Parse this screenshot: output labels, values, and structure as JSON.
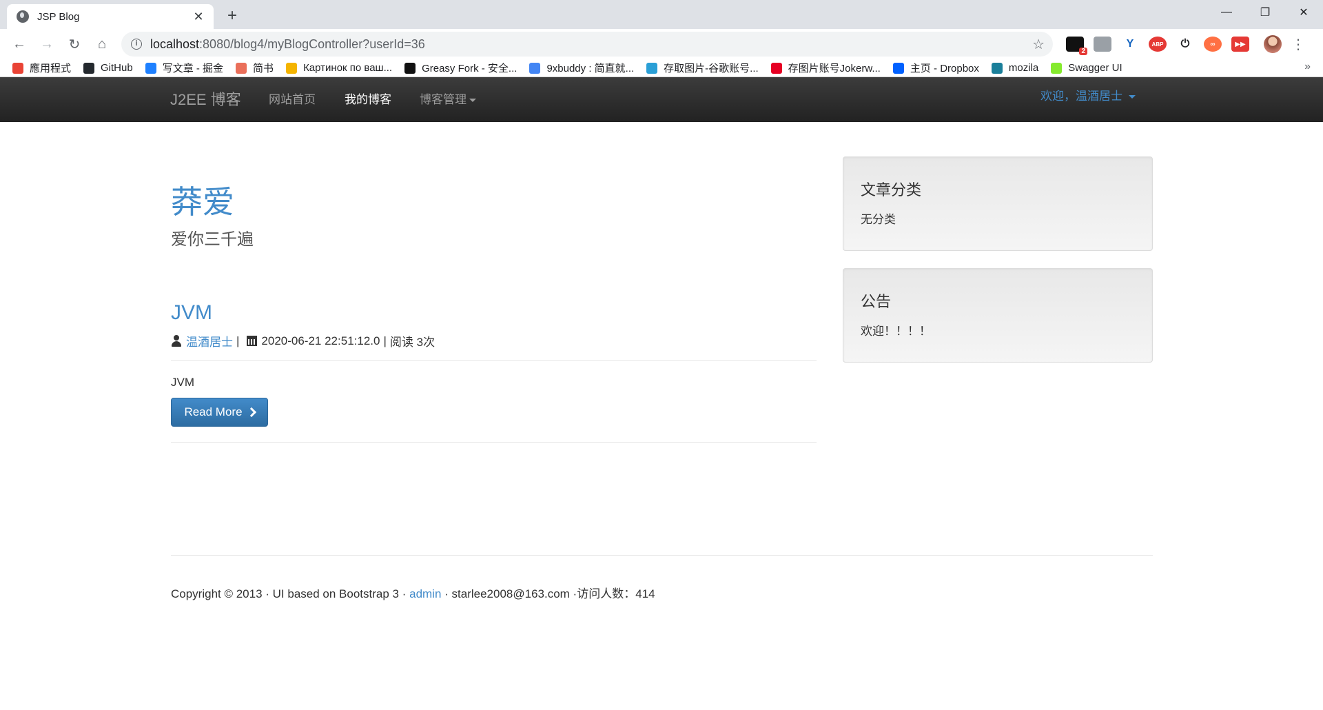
{
  "browser": {
    "tab_title": "JSP Blog",
    "url_host": "localhost",
    "url_path": ":8080/blog4/myBlogController?userId=36",
    "bookmarks": [
      {
        "label": "應用程式",
        "icon": "apps-grid-icon",
        "color": "#e94335"
      },
      {
        "label": "GitHub",
        "icon": "github-icon",
        "color": "#24292e"
      },
      {
        "label": "写文章 - 掘金",
        "icon": "juejin-icon",
        "color": "#1e80ff"
      },
      {
        "label": "简书",
        "icon": "jianshu-icon",
        "color": "#ea6f5a"
      },
      {
        "label": "Картинок по ваш...",
        "icon": "image-icon",
        "color": "#f4b400"
      },
      {
        "label": "Greasy Fork - 安全...",
        "icon": "greasyfork-icon",
        "color": "#111111"
      },
      {
        "label": "9xbuddy : 简直就...",
        "icon": "doc-icon",
        "color": "#4285f4"
      },
      {
        "label": "存取图片-谷歌账号...",
        "icon": "ibb-icon",
        "color": "#2a9fd6"
      },
      {
        "label": "存图片账号Jokerw...",
        "icon": "pinterest-icon",
        "color": "#e60023"
      },
      {
        "label": "主页 - Dropbox",
        "icon": "dropbox-icon",
        "color": "#0061ff"
      },
      {
        "label": "mozila",
        "icon": "mozilla-icon",
        "color": "#1a7f9a"
      },
      {
        "label": "Swagger UI",
        "icon": "swagger-icon",
        "color": "#85ea2d"
      }
    ],
    "ext_badge": "2"
  },
  "navbar": {
    "brand": "J2EE 博客",
    "links": [
      "网站首页",
      "我的博客",
      "博客管理"
    ],
    "welcome": "欢迎，温酒居士"
  },
  "blog": {
    "title": "莽爱",
    "subtitle": "爱你三千遍"
  },
  "post": {
    "title": "JVM",
    "author": "温酒居士",
    "sep1": "|",
    "date": "2020-06-21 22:51:12.0",
    "sep2": "|",
    "reads": "阅读 3次",
    "excerpt": "JVM",
    "read_more": "Read More"
  },
  "sidebar": {
    "category_title": "文章分类",
    "category_text": "无分类",
    "notice_title": "公告",
    "notice_text": "欢迎！！！！"
  },
  "footer": {
    "copyright": "Copyright © 2013 · UI based on Bootstrap 3 · ",
    "admin_link": "admin",
    "contact": " · starlee2008@163.com ·访问人数：414"
  }
}
